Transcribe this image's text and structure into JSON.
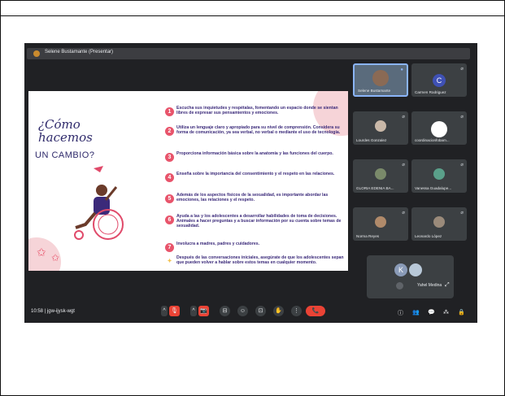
{
  "meeting": {
    "presenter_label": "Selene Bustamante (Presentar)",
    "time": "10:58",
    "separator": "|",
    "code": "jgw-ijysk-wgt"
  },
  "slide": {
    "title_line1": "¿Cómo",
    "title_line2": "hacemos",
    "title_line3": "UN CAMBIO?",
    "items": [
      {
        "num": "1",
        "text": "Escucha sus inquietudes y respétalas, fomentando un espacio donde se sientan libres de expresar sus pensamientos y emociones."
      },
      {
        "num": "2",
        "text": "Utiliza un lenguaje claro y apropiado para su nivel de comprensión. Considera su forma de comunicación, ya sea verbal, no verbal o mediante el uso de tecnología."
      },
      {
        "num": "3",
        "text": "Proporciona información básica sobre la anatomía y las funciones del cuerpo."
      },
      {
        "num": "4",
        "text": "Enseña sobre la importancia del consentimiento y el respeto en las relaciones."
      },
      {
        "num": "5",
        "text": "Además de los aspectos físicos de la sexualidad, es importante abordar las emociones, las relaciones y el respeto."
      },
      {
        "num": "6",
        "text": "Ayuda a las y los adolescentes a desarrollar habilidades de toma de decisiones. Anímales a hacer preguntas y a buscar información por su cuenta sobre temas de sexualidad."
      },
      {
        "num": "7",
        "text": "Involucra a madres, padres y cuidadores."
      },
      {
        "num": "✦",
        "text": "Después de las conversaciones iniciales, asegúrate de que los adolescentes sepan que pueden volver a hablar sobre estos temas en cualquier momento."
      }
    ]
  },
  "participants": [
    {
      "name": "Selene Bustamante",
      "avatar": "camera",
      "active": true
    },
    {
      "name": "Carmen Rodriguez",
      "avatar": "C"
    },
    {
      "name": "Lourdes Gonzalez",
      "avatar": "photo"
    },
    {
      "name": "coordinacionfobam...",
      "avatar": "logo"
    },
    {
      "name": "GLORIA EDENIA BA...",
      "avatar": "photo"
    },
    {
      "name": "Vanessa Guadalupe...",
      "avatar": "photo"
    },
    {
      "name": "Norma Reyes",
      "avatar": "photo"
    },
    {
      "name": "Leonardo López",
      "avatar": "photo"
    }
  ],
  "self_view": {
    "avatar_letter": "K",
    "name": "Yahel Medina"
  },
  "controls": {
    "raise_hand": "✋",
    "more": "⋮",
    "end_call": "📞"
  },
  "icons": {
    "mic_off": "🎙",
    "cam_off": "📷",
    "captions": "⊟",
    "emoji": "☺",
    "present": "⊡",
    "info": "ⓘ",
    "people": "👥",
    "chat": "💬",
    "activities": "⁂",
    "lock": "🔒",
    "expand": "⤢"
  },
  "colors": {
    "meet_bg": "#202124",
    "accent_red": "#ea4335",
    "slide_pink": "#e8546b",
    "slide_navy": "#2f2a6b"
  }
}
